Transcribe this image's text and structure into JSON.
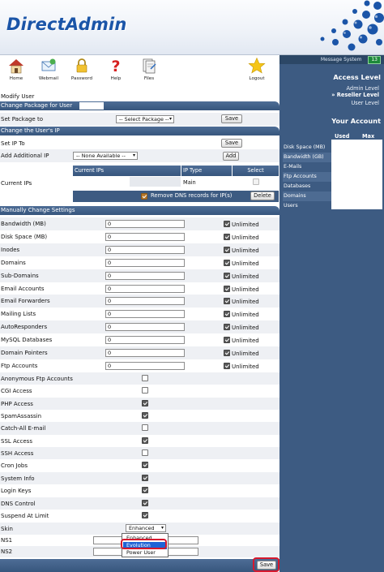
{
  "app": {
    "logo": "DirectAdmin"
  },
  "toolbar": [
    {
      "label": "Home",
      "icon": "home-icon"
    },
    {
      "label": "Webmail",
      "icon": "webmail-icon"
    },
    {
      "label": "Password",
      "icon": "lock-icon"
    },
    {
      "label": "Help",
      "icon": "help-icon"
    },
    {
      "label": "Files",
      "icon": "files-icon"
    },
    {
      "label": "Logout",
      "icon": "star-icon"
    }
  ],
  "sidebar": {
    "message_system": "Message System",
    "message_count": "13",
    "access_level_title": "Access Level",
    "levels": [
      "Admin Level",
      "» Reseller Level",
      "User Level"
    ],
    "account_title": "Your Account",
    "col_used": "Used",
    "col_max": "Max",
    "resources": [
      "Disk Space (MB)",
      "Bandwidth (GB)",
      "E-Mails",
      "Ftp Accounts",
      "Databases",
      "Domains",
      "Users"
    ]
  },
  "page": {
    "title": "Modify User",
    "sections": {
      "package": "Change Package for User",
      "ip": "Change the User's IP",
      "manual": "Manually Change Settings"
    },
    "set_package_label": "Set Package to",
    "set_package_value": "-- Select Package --",
    "save_label": "Save",
    "add_label": "Add",
    "delete_label": "Delete",
    "set_ip_label": "Set IP To",
    "add_ip_label": "Add Additional IP",
    "add_ip_value": "-- None Available --",
    "current_ips_label": "Current IPs",
    "ip_table_headers": [
      "Current IPs",
      "IP Type",
      "Select"
    ],
    "ip_type_value": "Main",
    "remove_dns_label": "Remove DNS records for IP(s)",
    "unlimited_label": "Unlimited",
    "numeric_settings": [
      {
        "label": "Bandwidth (MB)",
        "value": "0"
      },
      {
        "label": "Disk Space (MB)",
        "value": "0"
      },
      {
        "label": "Inodes",
        "value": "0"
      },
      {
        "label": "Domains",
        "value": "0"
      },
      {
        "label": "Sub-Domains",
        "value": "0"
      },
      {
        "label": "Email Accounts",
        "value": "0"
      },
      {
        "label": "Email Forwarders",
        "value": "0"
      },
      {
        "label": "Mailing Lists",
        "value": "0"
      },
      {
        "label": "AutoResponders",
        "value": "0"
      },
      {
        "label": "MySQL Databases",
        "value": "0"
      },
      {
        "label": "Domain Pointers",
        "value": "0"
      },
      {
        "label": "Ftp Accounts",
        "value": "0"
      }
    ],
    "feature_settings": [
      {
        "label": "Anonymous Ftp Accounts",
        "checked": false
      },
      {
        "label": "CGI Access",
        "checked": false
      },
      {
        "label": "PHP Access",
        "checked": true
      },
      {
        "label": "SpamAssassin",
        "checked": true
      },
      {
        "label": "Catch-All E-mail",
        "checked": false
      },
      {
        "label": "SSL Access",
        "checked": true
      },
      {
        "label": "SSH Access",
        "checked": false
      },
      {
        "label": "Cron Jobs",
        "checked": true
      },
      {
        "label": "System Info",
        "checked": true
      },
      {
        "label": "Login Keys",
        "checked": true
      },
      {
        "label": "DNS Control",
        "checked": true
      },
      {
        "label": "Suspend At Limit",
        "checked": true
      }
    ],
    "skin_label": "Skin",
    "skin_value": "Enhanced",
    "skin_options": [
      "Enhanced",
      "Evolution",
      "Power User"
    ],
    "ns1_label": "NS1",
    "ns2_label": "NS2"
  },
  "colors": {
    "accent": "#3d5b82",
    "header_blue": "#1b55a8",
    "highlight": "#d6192e",
    "selected_option": "#1e63d6"
  }
}
